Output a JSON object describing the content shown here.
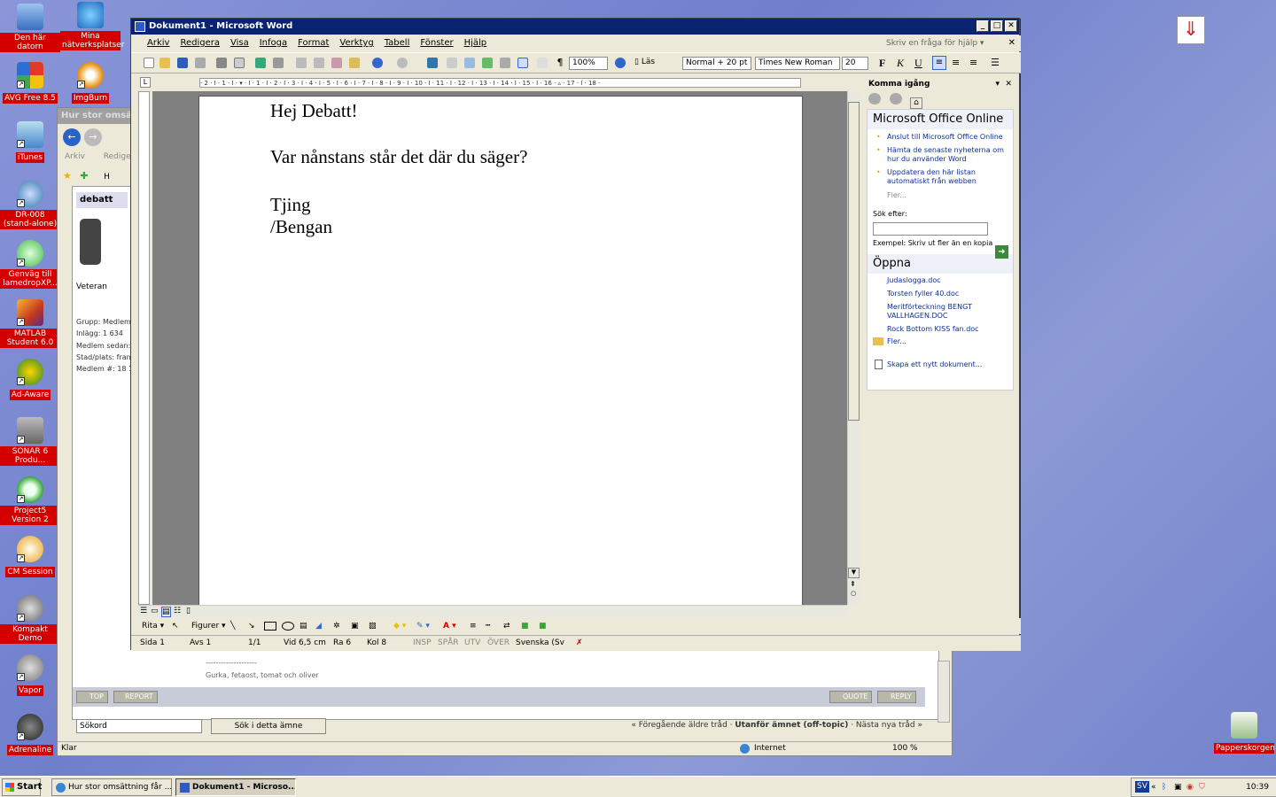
{
  "desktop": {
    "icons": [
      {
        "label": "Den här datorn",
        "icon": "my-computer-icon"
      },
      {
        "label": "Mina nätverksplatser",
        "icon": "network-places-icon"
      },
      {
        "label": "AVG Free 8.5",
        "icon": "avg-icon"
      },
      {
        "label": "ImgBurn",
        "icon": "imgburn-icon"
      },
      {
        "label": "iTunes",
        "icon": "itunes-icon"
      },
      {
        "label": "DR-008 (stand-alone)",
        "icon": "dr008-icon"
      },
      {
        "label": "Genväg till lamedropXP...",
        "icon": "lamedrop-icon"
      },
      {
        "label": "MATLAB Student 6.0",
        "icon": "matlab-icon"
      },
      {
        "label": "Ad-Aware",
        "icon": "adaware-icon"
      },
      {
        "label": "SONAR 6 Produ...",
        "icon": "sonar-icon"
      },
      {
        "label": "Project5 Version 2",
        "icon": "project5-icon"
      },
      {
        "label": "CM Session",
        "icon": "cm-session-icon"
      },
      {
        "label": "Kompakt Demo",
        "icon": "kompakt-icon"
      },
      {
        "label": "Vapor",
        "icon": "vapor-icon"
      },
      {
        "label": "Adrenaline",
        "icon": "adrenaline-icon"
      },
      {
        "label": "Papperskorgen",
        "icon": "recycle-bin-icon"
      }
    ]
  },
  "browser": {
    "title": "Hur stor omsättning får ...",
    "menu": [
      "Arkiv",
      "Redigera"
    ],
    "tab": "H",
    "post": {
      "author": "debatt",
      "rank": "Veteran",
      "group": "Grupp: Medlem",
      "posts": "Inlägg: 1 634",
      "member_since": "Medlem sedan:",
      "city": "Stad/plats: fran",
      "member_no": "Medlem #: 18 1",
      "signature_rule": "--------------------",
      "signature": "Gurka, fetaost, tomat och oliver"
    },
    "buttons": {
      "top": "TOP",
      "report": "REPORT",
      "quote": "QUOTE",
      "reply": "REPLY"
    },
    "search_value": "Sökord",
    "search_button": "Sök i detta ämne",
    "nav_prev": "« Föregående äldre tråd",
    "nav_current": "Utanför ämnet (off-topic)",
    "nav_next": "Nästa nya tråd »",
    "status_left": "Klar",
    "status_zone": "Internet",
    "status_zoom": "100 %"
  },
  "word": {
    "title": "Dokument1 - Microsoft Word",
    "menu": [
      "Arkiv",
      "Redigera",
      "Visa",
      "Infoga",
      "Format",
      "Verktyg",
      "Tabell",
      "Fönster",
      "Hjälp"
    ],
    "help_placeholder": "Skriv en fråga för hjälp",
    "zoom": "100%",
    "read_button": "Läs",
    "style": "Normal + 20 pt",
    "font": "Times New Roman",
    "size": "20",
    "ruler_text": "· 2 · I · 1 · I · ▾ · I · 1 · I · 2 · I · 3 · I · 4 · I · 5 · I · 6 · I · 7 · I · 8 · I · 9 · I · 10 · I · 11 · I · 12 · I · 13 · I · 14 · I · 15 · I · 16 · ▵ · 17 · I · 18 ·",
    "document_lines": [
      "Hej Debatt!",
      "",
      "Var nånstans står det där du säger?",
      "",
      "Tjing",
      "/Bengan"
    ],
    "draw": {
      "draw_label": "Rita",
      "shapes_label": "Figurer"
    },
    "status": {
      "page": "Sida  1",
      "section": "Avs  1",
      "pages": "1/1",
      "pos": "Vid  6,5 cm",
      "line": "Ra  6",
      "col": "Kol  8",
      "insp": "INSP",
      "spar": "SPÅR",
      "utv": "UTV",
      "over": "ÖVER",
      "lang": "Svenska (Sv"
    }
  },
  "taskpane": {
    "title": "Komma igång",
    "online_heading": "Microsoft Office Online",
    "online_links": [
      "Anslut till Microsoft Office Online",
      "Hämta de senaste nyheterna om hur du använder Word",
      "Uppdatera den här listan automatiskt från webben"
    ],
    "more1": "Fler...",
    "search_label": "Sök efter:",
    "search_example": "Exempel:  Skriv ut fler än en kopia",
    "open_heading": "Öppna",
    "recent_files": [
      "Judaslogga.doc",
      "Torsten fyller 40.doc",
      "Meritförteckning BENGT VALLHAGEN.DOC",
      "Rock Bottom KISS fan.doc"
    ],
    "more2": "Fler...",
    "new_doc": "Skapa ett nytt dokument..."
  },
  "taskbar": {
    "start": "Start",
    "tasks": [
      "Hur stor omsättning får ...",
      "Dokument1 - Microso..."
    ],
    "tray_lang": "SV",
    "clock": "10:39"
  }
}
